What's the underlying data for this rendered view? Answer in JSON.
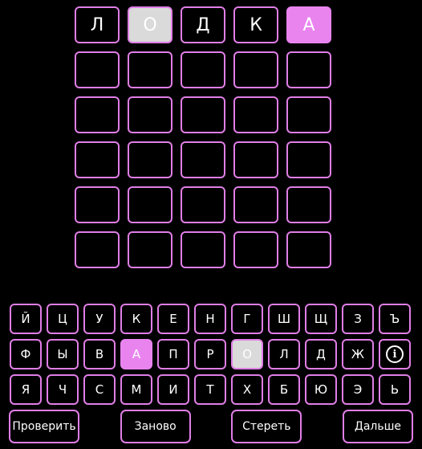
{
  "board": [
    [
      {
        "letter": "Л",
        "state": "empty"
      },
      {
        "letter": "О",
        "state": "present"
      },
      {
        "letter": "Д",
        "state": "empty"
      },
      {
        "letter": "К",
        "state": "empty"
      },
      {
        "letter": "А",
        "state": "correct"
      }
    ],
    [
      {
        "letter": "",
        "state": "empty"
      },
      {
        "letter": "",
        "state": "empty"
      },
      {
        "letter": "",
        "state": "empty"
      },
      {
        "letter": "",
        "state": "empty"
      },
      {
        "letter": "",
        "state": "empty"
      }
    ],
    [
      {
        "letter": "",
        "state": "empty"
      },
      {
        "letter": "",
        "state": "empty"
      },
      {
        "letter": "",
        "state": "empty"
      },
      {
        "letter": "",
        "state": "empty"
      },
      {
        "letter": "",
        "state": "empty"
      }
    ],
    [
      {
        "letter": "",
        "state": "empty"
      },
      {
        "letter": "",
        "state": "empty"
      },
      {
        "letter": "",
        "state": "empty"
      },
      {
        "letter": "",
        "state": "empty"
      },
      {
        "letter": "",
        "state": "empty"
      }
    ],
    [
      {
        "letter": "",
        "state": "empty"
      },
      {
        "letter": "",
        "state": "empty"
      },
      {
        "letter": "",
        "state": "empty"
      },
      {
        "letter": "",
        "state": "empty"
      },
      {
        "letter": "",
        "state": "empty"
      }
    ],
    [
      {
        "letter": "",
        "state": "empty"
      },
      {
        "letter": "",
        "state": "empty"
      },
      {
        "letter": "",
        "state": "empty"
      },
      {
        "letter": "",
        "state": "empty"
      },
      {
        "letter": "",
        "state": "empty"
      }
    ]
  ],
  "keyboard": {
    "rows": [
      [
        "Й",
        "Ц",
        "У",
        "К",
        "Е",
        "Н",
        "Г",
        "Ш",
        "Щ",
        "З",
        "Ъ"
      ],
      [
        "Ф",
        "Ы",
        "В",
        "А",
        "П",
        "Р",
        "О",
        "Л",
        "Д",
        "Ж",
        "info"
      ],
      [
        "Я",
        "Ч",
        "С",
        "М",
        "И",
        "Т",
        "Х",
        "Б",
        "Ю",
        "Э",
        "Ь"
      ]
    ],
    "states": {
      "А": "correct",
      "О": "present"
    },
    "info_icon": "info-icon"
  },
  "actions": {
    "check_label": "Проверить",
    "restart_label": "Заново",
    "erase_label": "Стереть",
    "next_label": "Дальше"
  },
  "colors": {
    "accent": "#e07ee6",
    "correct": "#e984ef",
    "present": "#dadada",
    "background": "#000000"
  }
}
